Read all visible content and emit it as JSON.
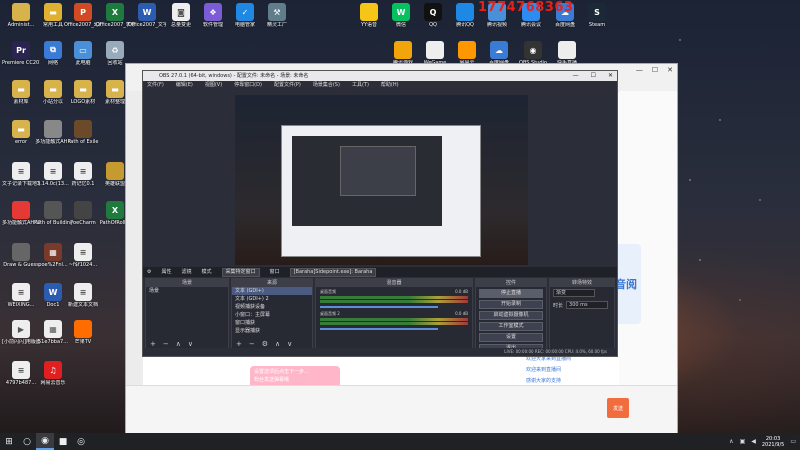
{
  "watermark_text": "1774768363",
  "desktop": {
    "left_icons": [
      {
        "id": "admin",
        "label": "Administ...",
        "color": "#d8b24a",
        "glyph": "user-folder-icon"
      },
      {
        "id": "tools",
        "label": "常用工具",
        "color": "#e0b030",
        "glyph": "folder-icon"
      },
      {
        "id": "ppt",
        "label": "Office2007_幻灯片PPT",
        "color": "#d04a23",
        "glyph": "powerpoint-icon"
      },
      {
        "id": "excel",
        "label": "Office2007_表格",
        "color": "#1f7a3d",
        "glyph": "excel-icon"
      },
      {
        "id": "word",
        "label": "Office2007_文字",
        "color": "#2b5cb0",
        "glyph": "word-icon"
      },
      {
        "id": "camera",
        "label": "总量变更",
        "color": "#eee",
        "glyph": "camera-icon"
      },
      {
        "id": "soft",
        "label": "软件管理",
        "color": "#7b5bd6",
        "glyph": "software-manager-icon"
      },
      {
        "id": "pcmgr",
        "label": "电脑管家",
        "color": "#1e88e5",
        "glyph": "shield-icon"
      },
      {
        "id": "fix",
        "label": "精灵工厂",
        "color": "#607d8b",
        "glyph": "wrench-icon"
      },
      {
        "id": "premiere",
        "label": "Premiere CC2019",
        "color": "#2a2450",
        "glyph": "premiere-icon"
      },
      {
        "id": "network",
        "label": "网络",
        "color": "#3a7bd5",
        "glyph": "network-icon"
      },
      {
        "id": "thispc",
        "label": "此电脑",
        "color": "#4a90d9",
        "glyph": "computer-icon"
      },
      {
        "id": "recycle",
        "label": "回收站",
        "color": "#9ab",
        "glyph": "recycle-bin-icon"
      },
      {
        "id": "mat",
        "label": "素材库",
        "color": "#d8b24a",
        "glyph": "folder-icon"
      },
      {
        "id": "miniapp",
        "label": "小站分以",
        "color": "#d8b24a",
        "glyph": "folder-icon"
      },
      {
        "id": "logo",
        "label": "LOGO素材",
        "color": "#d8b24a",
        "glyph": "folder-icon"
      },
      {
        "id": "mat2",
        "label": "素材整理",
        "color": "#d8b24a",
        "glyph": "folder-icon"
      },
      {
        "id": "error",
        "label": "error",
        "color": "#d8b24a",
        "glyph": "folder-icon"
      },
      {
        "id": "ahk",
        "label": "多功能触式AHK",
        "color": "#888",
        "glyph": "script-icon"
      },
      {
        "id": "poe",
        "label": "Path of Exile",
        "color": "#6b4a2a",
        "glyph": "poe-icon"
      },
      {
        "id": "txt1",
        "label": "文子记录下载地址",
        "color": "#eee",
        "glyph": "text-file-icon"
      },
      {
        "id": "v314",
        "label": "3.14.0c(13...",
        "color": "#eee",
        "glyph": "text-file-icon"
      },
      {
        "id": "jl",
        "label": "药记忆0.1",
        "color": "#eee",
        "glyph": "text-file-icon"
      },
      {
        "id": "lol",
        "label": "英雄联盟",
        "color": "#c59a2e",
        "glyph": "game-icon"
      },
      {
        "id": "ahk2",
        "label": "多功能触式AHK20.19...",
        "color": "#e53935",
        "glyph": "ahk-icon"
      },
      {
        "id": "pob",
        "label": "Path of Building",
        "color": "#555",
        "glyph": "pob-icon"
      },
      {
        "id": "poecharm",
        "label": "PoeCharm",
        "color": "#444",
        "glyph": "charm-icon"
      },
      {
        "id": "poeroll",
        "label": "PathOfRoll...",
        "color": "#1f7a3d",
        "glyph": "excel-icon"
      },
      {
        "id": "drawguess",
        "label": "Draw & Guess",
        "color": "#666",
        "glyph": "game-icon"
      },
      {
        "id": "poe2",
        "label": "poe%2Fnl...",
        "color": "#7a3a2a",
        "glyph": "image-icon"
      },
      {
        "id": "f1024",
        "label": "~f$f1024...",
        "color": "#eee",
        "glyph": "text-file-icon"
      },
      {
        "id": "wexin",
        "label": "WEIXING...",
        "color": "#eee",
        "glyph": "text-file-icon"
      },
      {
        "id": "doc1",
        "label": "Doc1",
        "color": "#2b5cb0",
        "glyph": "word-icon"
      },
      {
        "id": "newtxt",
        "label": "新建文本文档",
        "color": "#eee",
        "glyph": "text-file-icon"
      },
      {
        "id": "video",
        "label": "[小前闪闪]用版面素",
        "color": "#eee",
        "glyph": "video-file-icon"
      },
      {
        "id": "hash",
        "label": "51e7bba7...",
        "color": "#eee",
        "glyph": "image-icon"
      },
      {
        "id": "mgtv",
        "label": "芒果TV",
        "color": "#ff6d00",
        "glyph": "mgtv-icon"
      },
      {
        "id": "hash2",
        "label": "4797b487...",
        "color": "#eee",
        "glyph": "text-file-icon"
      },
      {
        "id": "neteasemusic",
        "label": "网易云音乐",
        "color": "#e02020",
        "glyph": "music-icon"
      }
    ],
    "top_icons": [
      {
        "id": "yy",
        "label": "YY语音",
        "color": "#f5c518",
        "glyph": "yy-icon"
      },
      {
        "id": "wechat",
        "label": "微信",
        "color": "#07c160",
        "glyph": "wechat-icon"
      },
      {
        "id": "qq",
        "label": "QQ",
        "color": "#111",
        "glyph": "qq-icon"
      },
      {
        "id": "tencent",
        "label": "腾讯QQ",
        "color": "#1e88e5",
        "glyph": "app-icon"
      },
      {
        "id": "file1",
        "label": "腾讯视频",
        "color": "#4a90d9",
        "glyph": "app-icon"
      },
      {
        "id": "grid",
        "label": "腾讯会议",
        "color": "#2d8cf0",
        "glyph": "app-icon"
      },
      {
        "id": "baidunet",
        "label": "百度网盘",
        "color": "#3a7bd5",
        "glyph": "cloud-icon"
      },
      {
        "id": "steam",
        "label": "Steam",
        "color": "#1b2838",
        "glyph": "steam-icon"
      },
      {
        "id": "app2",
        "label": "腾讯游戏",
        "color": "#f2a50a",
        "glyph": "app-icon"
      },
      {
        "id": "wegame",
        "label": "WeGame",
        "color": "#eee",
        "glyph": "wegame-icon"
      },
      {
        "id": "netwc",
        "label": "网易云",
        "color": "#ff9800",
        "glyph": "app-icon"
      },
      {
        "id": "baidu2",
        "label": "百度网盘",
        "color": "#3a7bd5",
        "glyph": "cloud-icon"
      },
      {
        "id": "obsdesk",
        "label": "OBS Studio",
        "color": "#333",
        "glyph": "obs-icon"
      },
      {
        "id": "flash",
        "label": "快手直播",
        "color": "#eee",
        "glyph": "flash-icon"
      }
    ]
  },
  "browser": {
    "promo_text": "音阅",
    "pink_banner": [
      "设置选项后点击下一步...",
      "粉丝发送弹幕哦"
    ],
    "right_list": [
      "欢迎大家来到直播间",
      "欢迎来到直播间",
      "感谢大家的支持"
    ],
    "send_label": "发送"
  },
  "obs": {
    "title": "OBS 27.0.1 (64-bit, windows) - 配置文件: 未命名 - 场景: 未命名",
    "menu": [
      "文件(F)",
      "编辑(E)",
      "视图(V)",
      "停靠窗口(D)",
      "配置文件(P)",
      "场景集合(S)",
      "工具(T)",
      "帮助(H)"
    ],
    "source_toolbar": {
      "prop_label": "属性",
      "filter_label": "滤镜",
      "mode_label": "模式",
      "mode_value": "采集特定窗口",
      "window_label": "窗口",
      "window_value": "[Baraha]Sidepoint.exe]: Baraha"
    },
    "scene_panel": {
      "header": "场景",
      "items": [
        "场景"
      ]
    },
    "sources_panel": {
      "header": "来源",
      "items": [
        "文本 (GDI+)",
        "文本 (GDI+) 2",
        "视频捕获设备",
        "小窗口：主屏幕",
        "窗口捕获",
        "显示器捕获"
      ]
    },
    "mixer_panel": {
      "header": "混音器",
      "tracks": [
        {
          "name": "桌面音频",
          "db": "0.0 dB"
        },
        {
          "name": "桌面音频 2",
          "db": "0.0 dB"
        }
      ]
    },
    "controls_panel": {
      "header": "控件",
      "buttons": [
        "停止直播",
        "开始录制",
        "启动虚拟摄像机",
        "工作室模式",
        "设置",
        "退出"
      ]
    },
    "transition_panel": {
      "header": "转场特效",
      "type_label": "渐变",
      "duration_label": "时长",
      "duration_value": "300 ms"
    },
    "status_bar": "LIVE: 00:00:00  REC: 00:00:00  CPU: 4.0%, 60.00 fps"
  },
  "taskbar": {
    "clock_time": "20:03",
    "clock_date": "2021/9/5"
  }
}
